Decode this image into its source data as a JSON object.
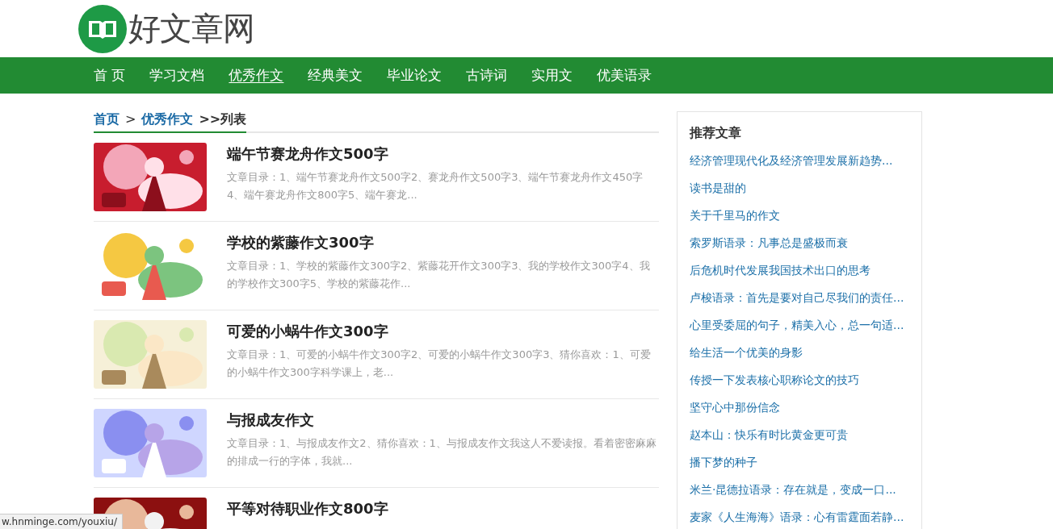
{
  "site": {
    "logo_text": "好文章网"
  },
  "nav": [
    {
      "label": "首 页",
      "selected": false
    },
    {
      "label": "学习文档",
      "selected": false
    },
    {
      "label": "优秀作文",
      "selected": true
    },
    {
      "label": "经典美文",
      "selected": false
    },
    {
      "label": "毕业论文",
      "selected": false
    },
    {
      "label": "古诗词",
      "selected": false
    },
    {
      "label": "实用文",
      "selected": false
    },
    {
      "label": "优美语录",
      "selected": false
    }
  ],
  "breadcrumb": {
    "links": [
      "首页",
      "优秀作文"
    ],
    "separator": ">",
    "current": ">>列表"
  },
  "articles": [
    {
      "title": "端午节赛龙舟作文500字",
      "summary": "文章目录：1、端午节赛龙舟作文500字2、赛龙舟作文500字3、端午节赛龙舟作文450字4、端午赛龙舟作文800字5、端午赛龙..."
    },
    {
      "title": "学校的紫藤作文300字",
      "summary": "文章目录：1、学校的紫藤作文300字2、紫藤花开作文300字3、我的学校作文300字4、我的学校作文300字5、学校的紫藤花作..."
    },
    {
      "title": "可爱的小蜗牛作文300字",
      "summary": "文章目录：1、可爱的小蜗牛作文300字2、可爱的小蜗牛作文300字3、猜你喜欢：1、可爱的小蜗牛作文300字科学课上，老..."
    },
    {
      "title": "与报成友作文",
      "summary": "文章目录：1、与报成友作文2、猜你喜欢：1、与报成友作文我这人不爱读报。看着密密麻麻的排成一行的字体，我就..."
    },
    {
      "title": "平等对待职业作文800字"
    }
  ],
  "sidebar": {
    "title": "推荐文章",
    "links": [
      "经济管理现代化及经济管理发展新趋势...",
      "读书是甜的",
      "关于千里马的作文",
      "索罗斯语录：凡事总是盛极而衰",
      "后危机时代发展我国技术出口的思考",
      "卢梭语录：首先是要对自己尽我们的责任...",
      "心里受委屈的句子，精美入心，总一句适...",
      "给生活一个优美的身影",
      "传授一下发表核心职称论文的技巧",
      "坚守心中那份信念",
      "赵本山：快乐有时比黄金更可贵",
      "播下梦的种子",
      "米兰·昆德拉语录：存在就是，变成一口...",
      "麦家《人生海海》语录：心有雷霆面若静..."
    ]
  },
  "status_bar": {
    "url": "w.hnminge.com/youxiu/"
  }
}
